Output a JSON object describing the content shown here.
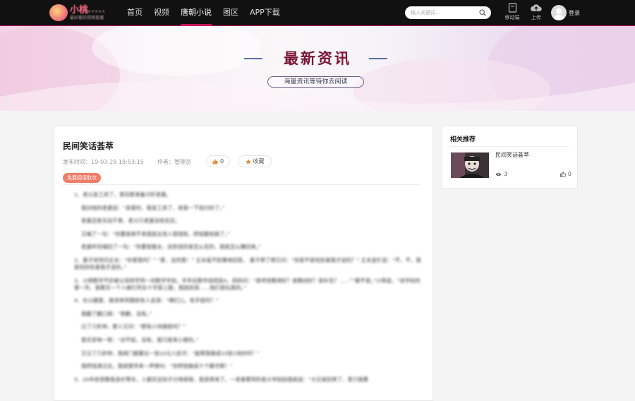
{
  "header": {
    "logo_main": "小桃",
    "logo_tagline": "最好看的视频直播",
    "logo_en": "××××××",
    "nav": [
      {
        "label": "首页",
        "active": false
      },
      {
        "label": "视频",
        "active": false
      },
      {
        "label": "唐朝小说",
        "active": true
      },
      {
        "label": "图区",
        "active": false
      },
      {
        "label": "APP下载",
        "active": false
      }
    ],
    "search_placeholder": "输入关键词...",
    "mobile_label": "移动端",
    "upload_label": "上传",
    "login_label": "登录"
  },
  "banner": {
    "title": "最新资讯",
    "subtitle": "海量资讯等待你去阅读"
  },
  "article": {
    "title": "民间笑话荟萃",
    "publish_time": "发布时间：19-03-28 18:53:15",
    "author": "作者：管理员",
    "like_count": "0",
    "favorite_label": "收藏",
    "badge": "免费阅读取次",
    "paragraphs": [
      "1、老公发工资了，拿回家准备讨好老婆。",
      "我对他的老婆说：“亲爱的，我发工资了，亲我一下钱归你了。”",
      "老婆还是无动于衷，老公只老婆没有反应。",
      "又喊了一句：“你要是再不来我就去找人借钱啦，把钱都给她了。”",
      "老婆听完喊回了一句：“你要是敢去，这些钱你是怎么花的，我就怎么赚回来。”",
      "2、妻子突然问丈夫：“你爱我吗？” “爱，当然爱！” 丈夫毫不犹豫地回答。 妻子想了想又问：“你是不是怕伤害我才说的？” 丈夫连忙说：“不、不，我是怕你伤害我才说的。”",
      "3、小明数学不好被父母转学到一间数学学校。半年后数学成绩变A，妈妈问：“是师资教得好？是教材好？是补告？……”“都不是。”小明说，“进学校的第一天，我看见一个人被钉死在十字架上面，我就知道……他们是玩真的。”",
      "4、在公園里，我领来到跟前有人说道：“喂们儿，有手纸吗？”",
      "我翻了翻口袋：“抱歉，没有。”",
      "过了几秒钟，那人又问：“那有小块报纸吗？”",
      "我无奈地一笑：“对不起，没有，我只是来小便的。”",
      "又过了几秒钟，我闻门缝塞出一张10元人民币：“能帮我换成10张1块的吗？”",
      "我把钱递过去，我闻里传来一声惨叫：“你把钱换成十个硬币啊！”",
      "5、20年前曾教我身价等车，人都买这别子分得很很，我曾再来了。一老者看到的老大爷拍拍我肩说：“大兄弟别哭了，拿只我看"
    ]
  },
  "sidebar": {
    "title": "相关推荐",
    "item_title": "民间笑话荟萃",
    "views": "3",
    "likes": "0"
  },
  "colors": {
    "accent": "#c41a5e",
    "banner_title": "#7a1534",
    "badge": "#f07d68"
  }
}
